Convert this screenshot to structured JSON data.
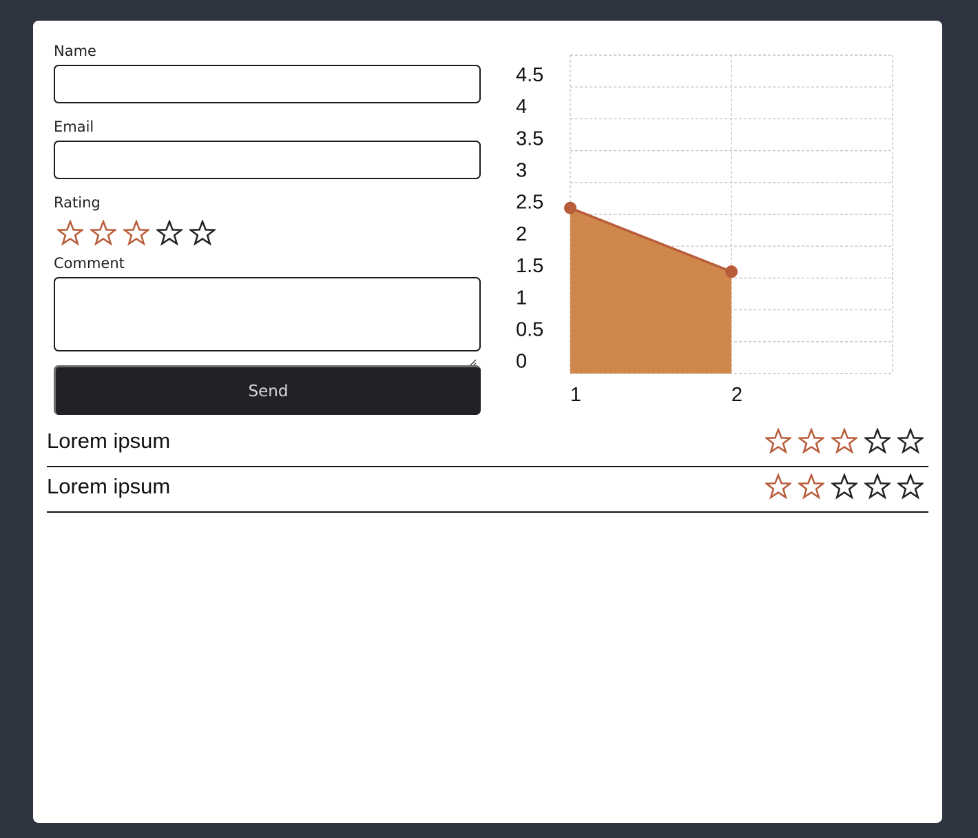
{
  "form": {
    "name_label": "Name",
    "name_value": "",
    "email_label": "Email",
    "email_value": "",
    "rating_label": "Rating",
    "rating_value": 3,
    "rating_max": 5,
    "comment_label": "Comment",
    "comment_value": "",
    "send_label": "Send"
  },
  "colors": {
    "star_filled": "#b85c3a",
    "star_empty": "#222222",
    "area_fill": "#cf874c",
    "line": "#b85c3a",
    "button_bg": "#222226"
  },
  "chart_data": {
    "type": "area",
    "title": "",
    "xlabel": "",
    "ylabel": "",
    "x": [
      1,
      2
    ],
    "values": [
      2.6,
      1.6
    ],
    "xticks": [
      "1",
      "2"
    ],
    "yticks": [
      "0",
      "0.5",
      "1",
      "1.5",
      "2",
      "2.5",
      "3",
      "3.5",
      "4",
      "4.5"
    ],
    "ylim": [
      0,
      5
    ],
    "xlim": [
      1,
      3
    ],
    "grid": true
  },
  "reviews": [
    {
      "title": "Lorem ipsum",
      "rating": 3
    },
    {
      "title": "Lorem ipsum",
      "rating": 2
    }
  ]
}
